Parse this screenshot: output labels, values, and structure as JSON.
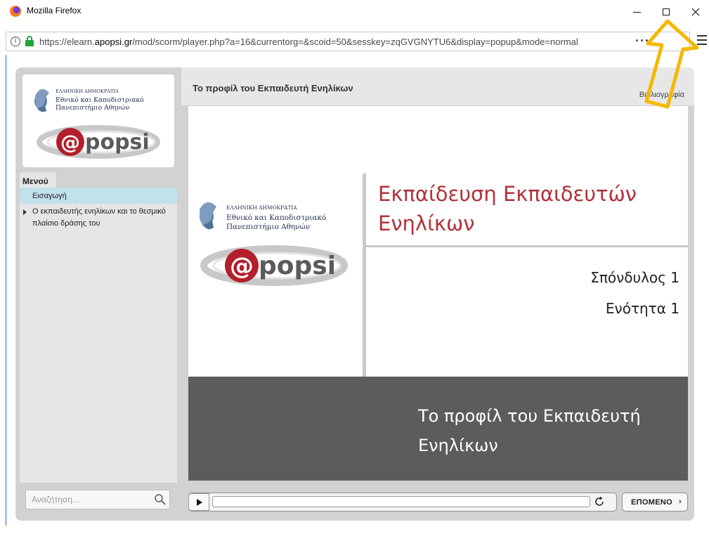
{
  "window": {
    "title": "Mozilla Firefox",
    "icon": "firefox-logo"
  },
  "urlbar": {
    "prefix": "https://elearn.",
    "domain": "apopsi.gr",
    "path": "/mod/scorm/player.php?a=16&currentorg=&scoid=50&sesskey=zqGVGNYTU6&display=popup&mode=normal",
    "overflow_icon": "dots-icon",
    "menu_icon": "hamburger-icon"
  },
  "sidebar": {
    "logo": {
      "line1": "ΕΛΛΗΝΙΚΗ ΔΗΜΟΚΡΑΤΙΑ",
      "line2": "Εθνικό και Καποδιστριακό",
      "line3": "Πανεπιστήμιο Αθηνών",
      "brand": "popsi",
      "brand_at": "@"
    },
    "menu_label": "Μενού",
    "items": [
      {
        "label": "Εισαγωγή",
        "active": true
      },
      {
        "label": "Ο εκπαιδευτής ενηλίκων και το θεσμικό πλαίσιο δράσης του",
        "active": false,
        "expandable": true
      }
    ],
    "search_placeholder": "Αναζήτηση..."
  },
  "content": {
    "title": "Το προφίλ του Εκπαιδευτή Ενηλίκων",
    "bibliography": "Βιβλιογραφία"
  },
  "slide": {
    "heading": "Εκπαίδευση Εκπαιδευτών Ενηλίκων",
    "module": "Σπόνδυλος 1",
    "unit": "Ενότητα 1",
    "footer_title": "Το προφίλ του Εκπαιδευτή Ενηλίκων"
  },
  "controls": {
    "progress_fraction": 0,
    "next_label": "ΕΠΟΜΕΝΟ",
    "next_chevron": "›"
  },
  "colors": {
    "slide_heading": "#b0323a",
    "band": "#5c5c5c",
    "active_item": "#c1e1ec",
    "arrow": "#f5b800"
  }
}
